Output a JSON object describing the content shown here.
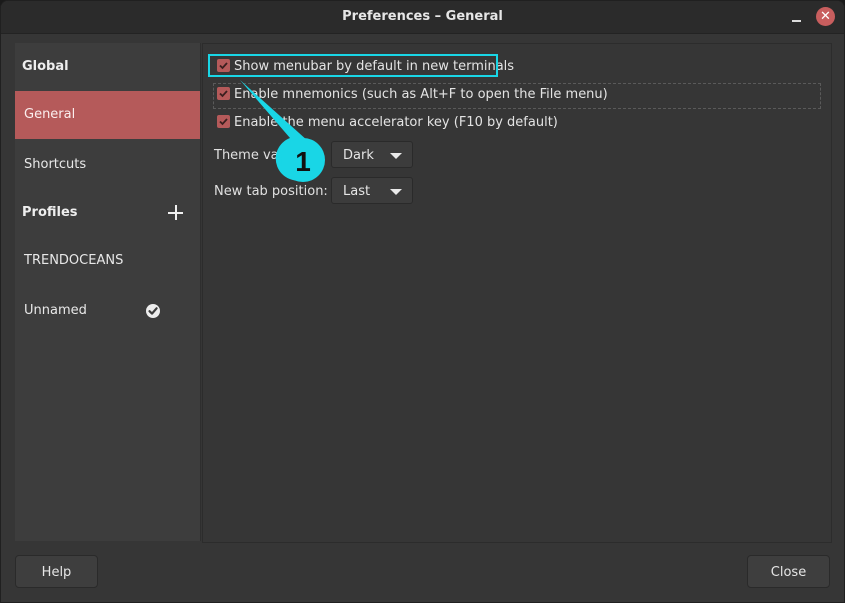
{
  "window": {
    "title": "Preferences – General",
    "minimize_icon": "minimize-icon",
    "close_icon": "close-icon"
  },
  "sidebar": {
    "global_header": "Global",
    "items": [
      {
        "label": "General",
        "active": true
      },
      {
        "label": "Shortcuts",
        "active": false
      }
    ],
    "profiles_header": "Profiles",
    "add_profile_icon": "plus-icon",
    "profiles": [
      {
        "label": "TRENDOCEANS",
        "default": false
      },
      {
        "label": "Unnamed",
        "default": true
      }
    ],
    "default_profile_icon": "check-circle-icon"
  },
  "general": {
    "checkboxes": [
      {
        "label": "Show menubar by default in new terminals",
        "checked": true
      },
      {
        "label": "Enable mnemonics (such as Alt+F to open the File menu)",
        "checked": true
      },
      {
        "label": "Enable the menu accelerator key (F10 by default)",
        "checked": true
      }
    ],
    "theme_variant": {
      "label": "Theme variant:",
      "value": "Dark"
    },
    "new_tab_position": {
      "label": "New tab position:",
      "value": "Last"
    }
  },
  "footer": {
    "help_label": "Help",
    "close_label": "Close"
  },
  "annotation": {
    "callout_number": "1",
    "highlight_color": "#19d6e6"
  },
  "colors": {
    "accent": "#b55a5a",
    "window_bg": "#363636",
    "sidebar_bg": "#3d3d3d",
    "close_button": "#c85e5e"
  }
}
